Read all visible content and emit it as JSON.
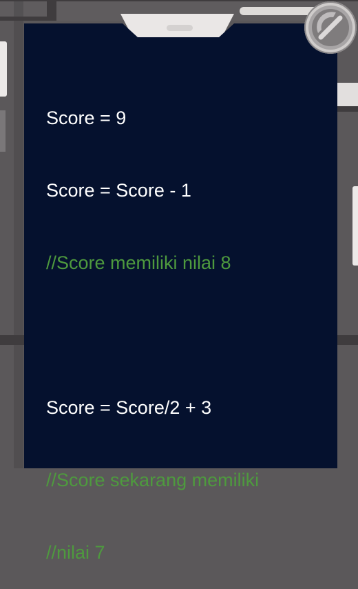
{
  "code_panel": {
    "lines": [
      {
        "text": "Score = 9",
        "kind": "statement"
      },
      {
        "text": "Score = Score - 1",
        "kind": "statement"
      },
      {
        "text": "//Score memiliki nilai 8",
        "kind": "comment"
      },
      {
        "text": "",
        "kind": "blank"
      },
      {
        "text": "Score = Score/2 + 3",
        "kind": "statement"
      },
      {
        "text": "//Score sekarang memiliki",
        "kind": "comment"
      },
      {
        "text": "//nilai 7",
        "kind": "comment"
      }
    ]
  },
  "colors": {
    "panel_background": "#05112e",
    "statement_text": "#ffffff",
    "comment_text": "#4e9a3e",
    "scene_background": "#5b585a"
  },
  "icons": {
    "close_button_icon": "close-icon"
  }
}
